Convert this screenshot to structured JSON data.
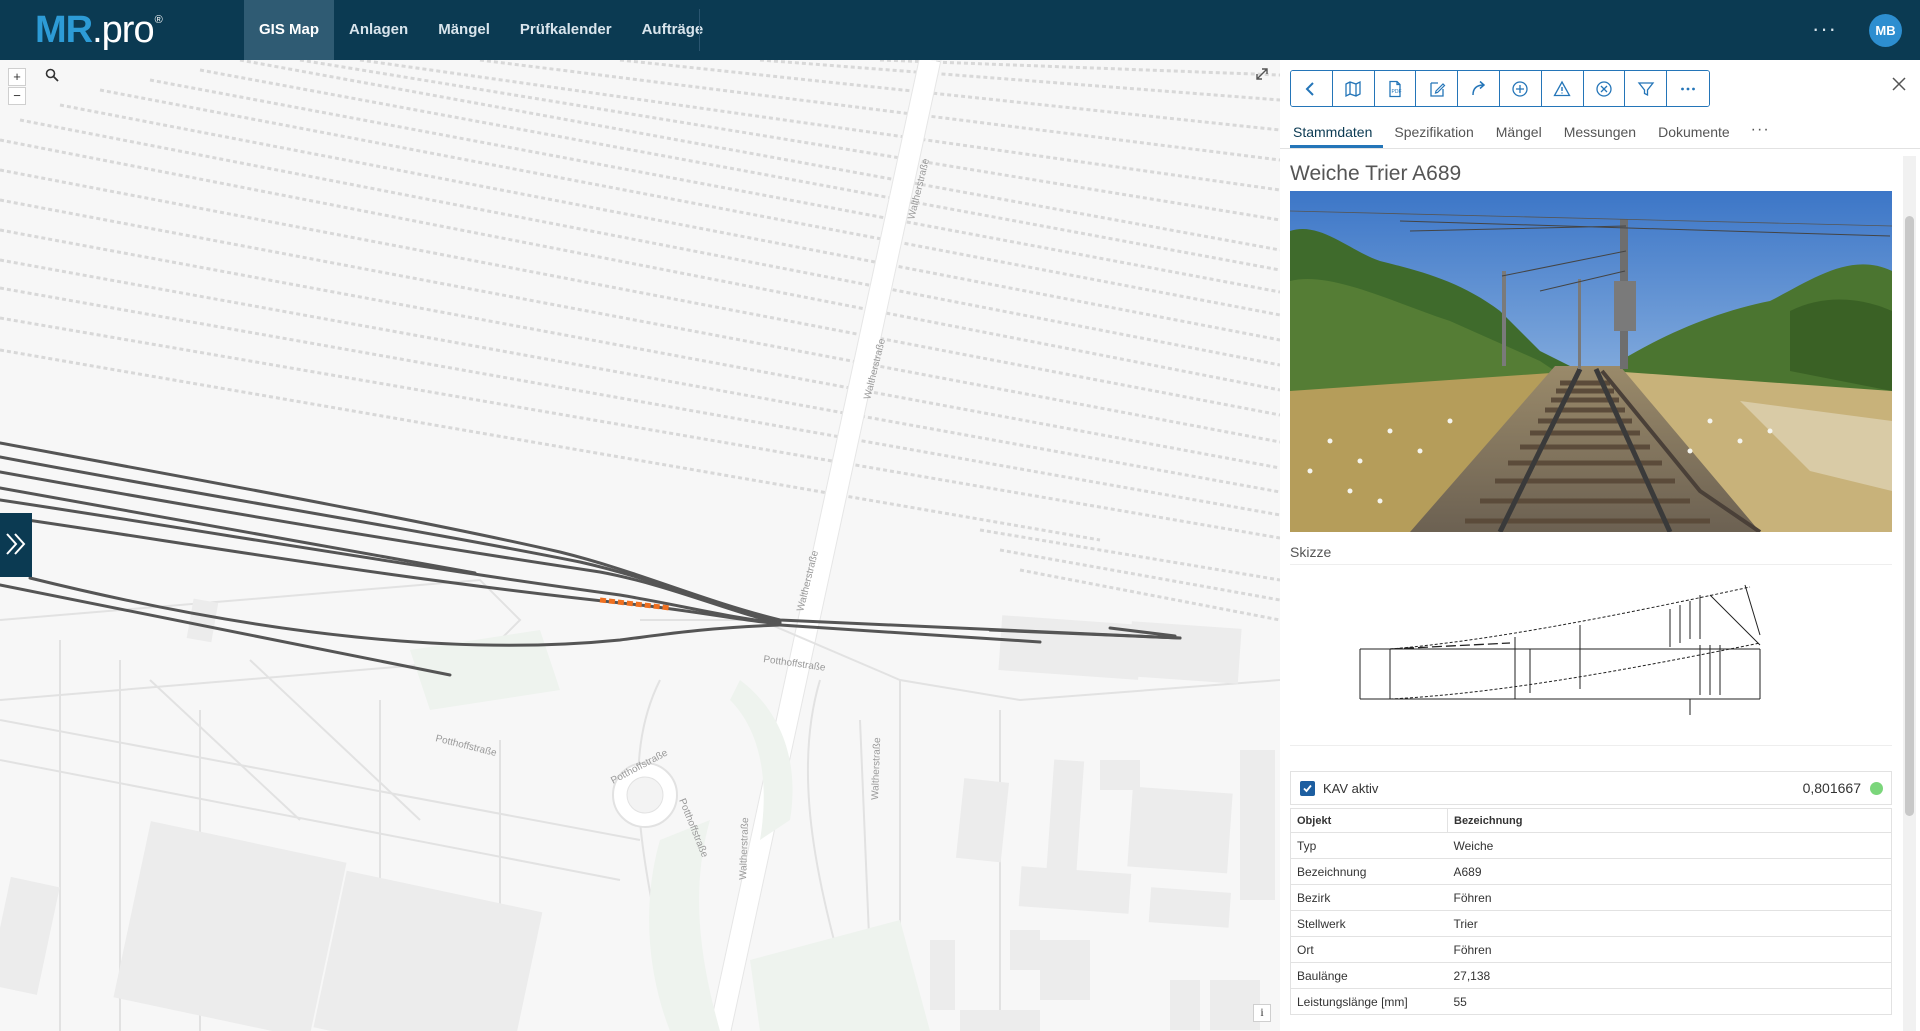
{
  "app": {
    "logo_main": "MR",
    "logo_sub": ".pro",
    "logo_reg": "®"
  },
  "nav": {
    "items": [
      {
        "label": "GIS Map",
        "active": true
      },
      {
        "label": "Anlagen"
      },
      {
        "label": "Mängel"
      },
      {
        "label": "Prüfkalender"
      },
      {
        "label": "Aufträge"
      }
    ],
    "more": "···",
    "user_initials": "MB"
  },
  "map": {
    "zoom_in": "+",
    "zoom_out": "−",
    "info": "i",
    "streets": [
      "Waltherstraße",
      "Waltherstraße",
      "Waltherstraße",
      "Potthoffstraße",
      "Potthoffstraße",
      "Potthoffstraße",
      "Potthoffstraße",
      "Waltherstraße",
      "Waltherstraße"
    ]
  },
  "toolbar": {
    "icons": [
      "chevron-left-icon",
      "map-icon",
      "document-icon",
      "edit-document-icon",
      "redo-icon",
      "plus-circle-icon",
      "warning-icon",
      "close-circle-icon",
      "filter-icon",
      "more-icon"
    ]
  },
  "tabs": {
    "items": [
      {
        "label": "Stammdaten",
        "active": true
      },
      {
        "label": "Spezifikation"
      },
      {
        "label": "Mängel"
      },
      {
        "label": "Messungen"
      },
      {
        "label": "Dokumente"
      }
    ],
    "more": "···"
  },
  "detail": {
    "title": "Weiche Trier A689",
    "skizze_label": "Skizze",
    "kav_label": "KAV aktiv",
    "kav_checked": true,
    "kav_value": "0,801667",
    "kav_status_color": "#7bd67b",
    "table": {
      "headers": [
        "Objekt",
        "Bezeichnung"
      ],
      "rows": [
        [
          "Typ",
          "Weiche"
        ],
        [
          "Bezeichnung",
          "A689"
        ],
        [
          "Bezirk",
          "Föhren"
        ],
        [
          "Stellwerk",
          "Trier"
        ],
        [
          "Ort",
          "Föhren"
        ],
        [
          "Baulänge",
          "27,138"
        ],
        [
          "Leistungslänge [mm]",
          "55"
        ]
      ]
    }
  },
  "colors": {
    "topbar": "#0b3a52",
    "accent": "#2475b8",
    "logo_blue": "#2d9bd6",
    "track": "#555555",
    "selected_track": "#f07020"
  }
}
